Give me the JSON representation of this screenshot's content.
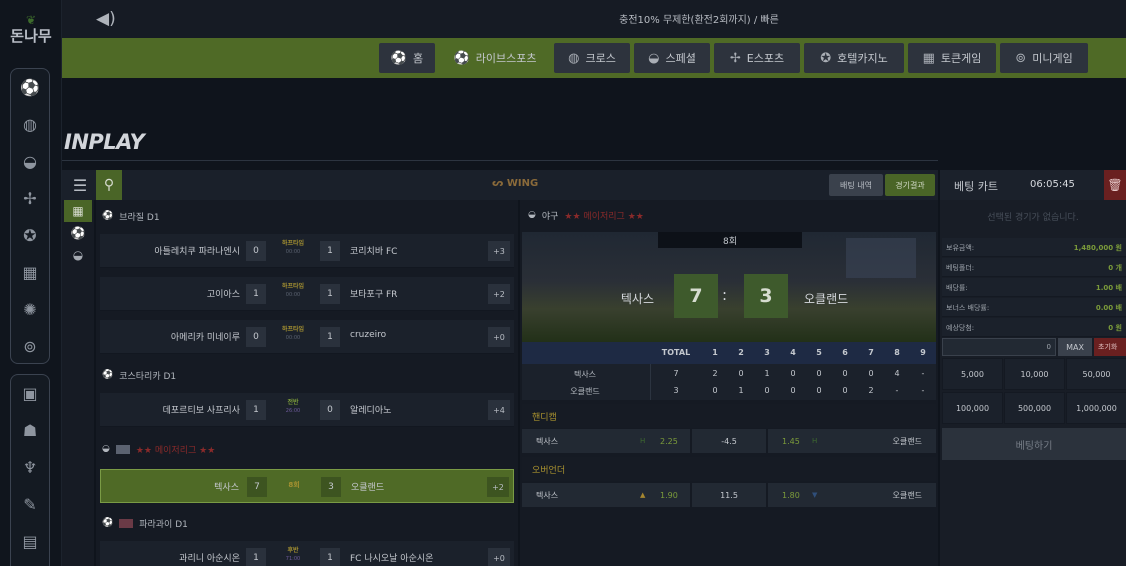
{
  "logo": {
    "text": "돈나무"
  },
  "rail": {
    "group1": [
      "soccer-icon",
      "basketball-icon",
      "baseball-icon",
      "esports-icon",
      "casino-chip-icon",
      "slot-icon",
      "roulette-icon",
      "gamepad-icon"
    ],
    "group2": [
      "wallet-icon",
      "people-icon",
      "microphone-icon",
      "pencil-icon",
      "gift-icon"
    ]
  },
  "topbar": {
    "notice": "충전10% 무제한(환전2회까지) / 빠른"
  },
  "nav": {
    "items": [
      {
        "label": "홈",
        "icon": "home-icon"
      },
      {
        "label": "라이브스포츠",
        "icon": "live-sports-icon"
      },
      {
        "label": "크로스",
        "icon": "cross-icon"
      },
      {
        "label": "스페셜",
        "icon": "special-icon"
      },
      {
        "label": "E스포츠",
        "icon": "esports-icon"
      },
      {
        "label": "호텔카지노",
        "icon": "hotel-casino-icon"
      },
      {
        "label": "토큰게임",
        "icon": "token-game-icon"
      },
      {
        "label": "미니게임",
        "icon": "mini-game-icon"
      }
    ]
  },
  "page": {
    "heading": "INPLAY"
  },
  "toolbar": {
    "brand": "WING",
    "history_label": "배팅 내역",
    "result_label": "경기결과"
  },
  "leagues": [
    {
      "name": "브라질 D1",
      "matches": [
        {
          "home": "아틀레치쿠 파라나엔시",
          "home_score": "0",
          "status": "하프타임",
          "time": "00:00",
          "away_score": "1",
          "away": "코리치바 FC",
          "more": "+3"
        },
        {
          "home": "고이아스",
          "home_score": "1",
          "status": "하프타임",
          "time": "00:00",
          "away_score": "1",
          "away": "보타포구 FR",
          "more": "+2"
        },
        {
          "home": "아메리카 미네이루",
          "home_score": "0",
          "status": "하프타임",
          "time": "00:00",
          "away_score": "1",
          "away": "cruzeiro",
          "more": "+0"
        }
      ]
    },
    {
      "name": "코스타리카 D1",
      "matches": [
        {
          "home": "데포르티보 사프리사",
          "home_score": "1",
          "status": "전반",
          "time": "26:00",
          "away_score": "0",
          "away": "알레디아노",
          "more": "+4"
        }
      ]
    },
    {
      "name": "메이저리그",
      "matches": [
        {
          "home": "텍사스",
          "home_score": "7",
          "status": "8회",
          "time": "",
          "away_score": "3",
          "away": "오클랜드",
          "more": "+2"
        }
      ]
    },
    {
      "name": "파라과이 D1",
      "matches": [
        {
          "home": "과리니 아순시온",
          "home_score": "1",
          "status": "후반",
          "time": "71:00",
          "away_score": "1",
          "away": "FC 나시오날 아순시온",
          "more": "+0"
        }
      ]
    }
  ],
  "detail": {
    "sport": "야구",
    "league": "메이저리그",
    "inning": "8회",
    "home_team": "텍사스",
    "away_team": "오클랜드",
    "home_score": "7",
    "away_score": "3",
    "linescore": {
      "headers": [
        "TOTAL",
        "1",
        "2",
        "3",
        "4",
        "5",
        "6",
        "7",
        "8",
        "9"
      ],
      "rows": [
        {
          "team": "텍사스",
          "cells": [
            "7",
            "2",
            "0",
            "1",
            "0",
            "0",
            "0",
            "0",
            "4",
            "-"
          ]
        },
        {
          "team": "오클랜드",
          "cells": [
            "3",
            "0",
            "1",
            "0",
            "0",
            "0",
            "0",
            "2",
            "-",
            "-"
          ]
        }
      ]
    },
    "markets": [
      {
        "title": "핸디캡",
        "home": "텍사스",
        "home_odds": "2.25",
        "line": "-4.5",
        "away_odds": "1.45",
        "away": "오클랜드"
      },
      {
        "title": "오버언더",
        "home": "텍사스",
        "home_odds": "1.90",
        "line": "11.5",
        "away_odds": "1.80",
        "away": "오클랜드"
      }
    ]
  },
  "cart": {
    "title": "베팅 카트",
    "time": "06:05:45",
    "empty_message": "선택된 경기가 없습니다.",
    "lines": [
      {
        "label": "보유금액:",
        "value": "1,480,000 원"
      },
      {
        "label": "베팅폴더:",
        "value": "0 개"
      },
      {
        "label": "배당률:",
        "value": "1.00 배"
      },
      {
        "label": "보너스 배당률:",
        "value": "0.00 배"
      },
      {
        "label": "예상당첨:",
        "value": "0 원"
      }
    ],
    "amount_value": "0",
    "max_label": "MAX",
    "reset_label": "초기화",
    "chips": [
      "5,000",
      "10,000",
      "50,000",
      "100,000",
      "500,000",
      "1,000,000"
    ],
    "bet_label": "베팅하기"
  }
}
